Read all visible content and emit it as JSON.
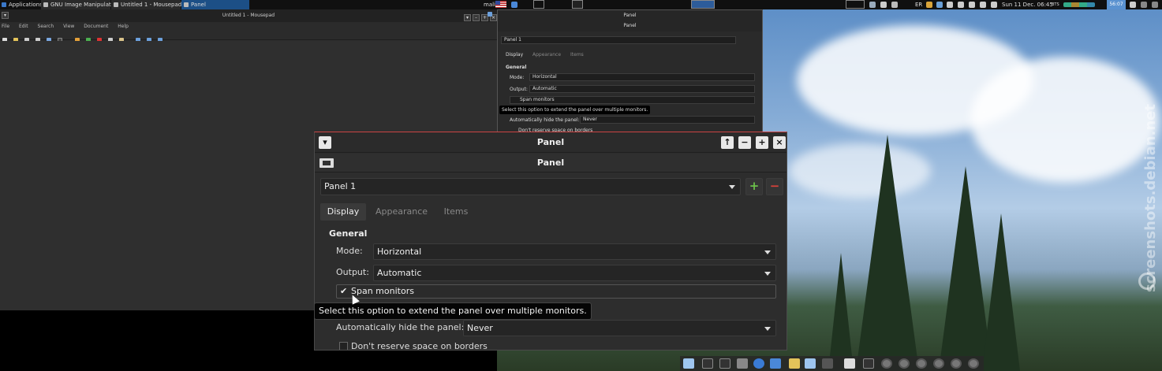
{
  "top_panel": {
    "applications_label": "Applications",
    "tasks": [
      {
        "label": "GNU Image Manipulatio...",
        "active": false
      },
      {
        "label": "Untitled 1 - Mousepad",
        "active": false
      },
      {
        "label": "Panel",
        "active": true
      }
    ],
    "user_label": "mali",
    "keyboard_layout": "ER",
    "clock": "Sun 11 Dec. 06:45",
    "bts_label": "BTS",
    "timer": "56:07"
  },
  "mousepad": {
    "title": "Untitled 1 - Mousepad",
    "menu": [
      "File",
      "Edit",
      "Search",
      "View",
      "Document",
      "Help"
    ]
  },
  "small_dialog": {
    "title": "Panel",
    "header_title": "Panel",
    "panel_select": "Panel 1",
    "tabs": [
      "Display",
      "Appearance",
      "Items"
    ],
    "section": "General",
    "mode_label": "Mode:",
    "mode_value": "Horizontal",
    "output_label": "Output:",
    "output_value": "Automatic",
    "span_label": "Span monitors",
    "tooltip": "Select this option to extend the panel over multiple monitors.",
    "autohide_label": "Automatically hide the panel:",
    "autohide_value": "Never",
    "reserve_label": "Don't reserve space on borders"
  },
  "panel_dialog": {
    "title": "Panel",
    "header_title": "Panel",
    "panel_select": "Panel 1",
    "add_symbol": "+",
    "remove_symbol": "−",
    "tabs": [
      "Display",
      "Appearance",
      "Items"
    ],
    "active_tab": "Display",
    "section": "General",
    "mode_label": "Mode:",
    "mode_value": "Horizontal",
    "output_label": "Output:",
    "output_value": "Automatic",
    "span_label": "Span monitors",
    "span_checked": true,
    "tooltip": "Select this option to extend the panel over multiple monitors.",
    "autohide_label": "Automatically hide the panel:",
    "autohide_value": "Never",
    "reserve_label": "Don't reserve space on borders",
    "reserve_checked": false
  },
  "watermark": "screenshots.debian.net",
  "colors": {
    "accent_blue": "#1c4f86",
    "add_green": "#6cc04a",
    "remove_red": "#d9423a",
    "titlebar_border": "#cc4444"
  }
}
